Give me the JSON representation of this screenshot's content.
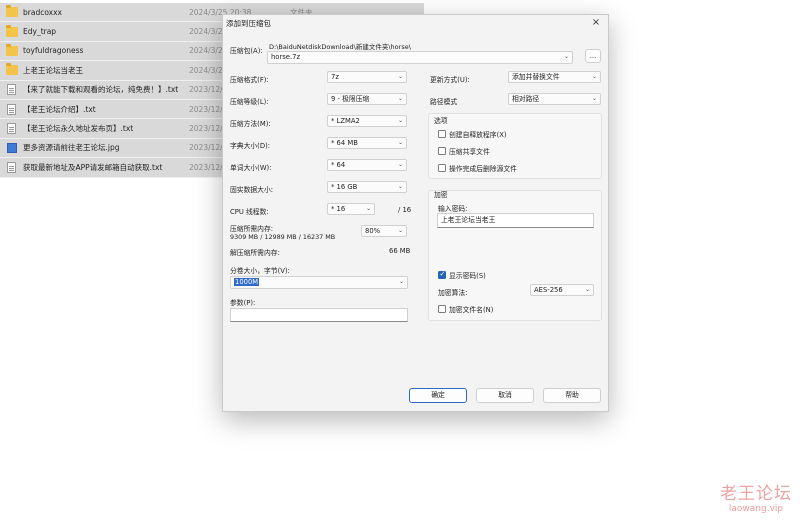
{
  "file_list": {
    "files": [
      {
        "icon": "folder-icon",
        "name": "bradcoxxx",
        "date": "2024/3/25 20:38",
        "type": "文件夹"
      },
      {
        "icon": "folder-icon",
        "name": "Edy_trap",
        "date": "2024/3/2",
        "type": ""
      },
      {
        "icon": "folder-icon",
        "name": "toyfuldragoness",
        "date": "2024/3/2",
        "type": ""
      },
      {
        "icon": "folder-icon",
        "name": "上老王论坛当老王",
        "date": "2024/3/2",
        "type": ""
      },
      {
        "icon": "text-file-icon",
        "name": "【来了就能下载和观看的论坛，纯免费！】.txt",
        "date": "2023/12/",
        "type": ""
      },
      {
        "icon": "text-file-icon",
        "name": "【老王论坛介绍】.txt",
        "date": "2023/12/",
        "type": ""
      },
      {
        "icon": "text-file-icon",
        "name": "【老王论坛永久地址发布页】.txt",
        "date": "2023/12/",
        "type": ""
      },
      {
        "icon": "image-file-icon",
        "name": "更多资源请前往老王论坛.jpg",
        "date": "2023/12/",
        "type": ""
      },
      {
        "icon": "text-file-icon",
        "name": "获取最新地址及APP请发邮箱自动获取.txt",
        "date": "2023/12/",
        "type": ""
      }
    ]
  },
  "dialog": {
    "title": "添加到压缩包",
    "close_icon": "×",
    "archive_label": "压缩包(A):",
    "archive_path": "D:\\BaiduNetdiskDownload\\新建文件夹\\horse\\",
    "archive_name": "horse.7z",
    "browse_label": "...",
    "format_label": "压缩格式(F):",
    "format_value": "7z",
    "level_label": "压缩等级(L):",
    "level_value": "9 - 极限压缩",
    "method_label": "压缩方法(M):",
    "method_value": "* LZMA2",
    "dict_label": "字典大小(D):",
    "dict_value": "* 64 MB",
    "word_label": "单词大小(W):",
    "word_value": "* 64",
    "solid_label": "固实数据大小:",
    "solid_value": "* 16 GB",
    "cpu_label": "CPU 线程数:",
    "cpu_value": "* 16",
    "cpu_total": "/ 16",
    "mem_label": "压缩所需内存:",
    "mem_detail": "9309 MB / 12989 MB / 16237 MB",
    "mem_percent": "80%",
    "decomp_label": "解压缩所需内存:",
    "decomp_value": "66 MB",
    "split_label": "分卷大小，字节(V):",
    "split_value": "1000M",
    "params_label": "参数(P):",
    "params_value": "",
    "update_label": "更新方式(U):",
    "update_value": "添加并替换文件",
    "pathmode_label": "路径模式",
    "pathmode_value": "相对路径",
    "options_title": "选项",
    "opt_sfx": "创建自释放程序(X)",
    "opt_shared": "压缩共享文件",
    "opt_delete": "操作完成后删除源文件",
    "encrypt_title": "加密",
    "password_label": "输入密码:",
    "password_value": "上老王论坛当老王",
    "show_password": "显示密码(S)",
    "enc_method_label": "加密算法:",
    "enc_method_value": "AES-256",
    "encrypt_names": "加密文件名(N)",
    "ok_label": "确定",
    "cancel_label": "取消",
    "help_label": "帮助"
  },
  "watermark": {
    "title": "老王论坛",
    "url": "laowang.vip"
  }
}
